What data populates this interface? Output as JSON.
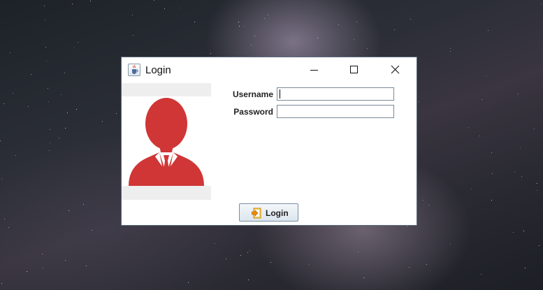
{
  "window": {
    "title": "Login",
    "app_icon": "java-cup-icon",
    "controls": {
      "minimize": "minimize-icon",
      "maximize": "maximize-icon",
      "close": "close-icon"
    }
  },
  "avatar": {
    "icon": "user-avatar-icon",
    "color": "#d03636"
  },
  "form": {
    "username_label": "Username",
    "username_value": "",
    "password_label": "Password",
    "password_value": ""
  },
  "login_button": {
    "label": "Login",
    "icon": "login-arrow-icon",
    "icon_color": "#f0a500"
  }
}
